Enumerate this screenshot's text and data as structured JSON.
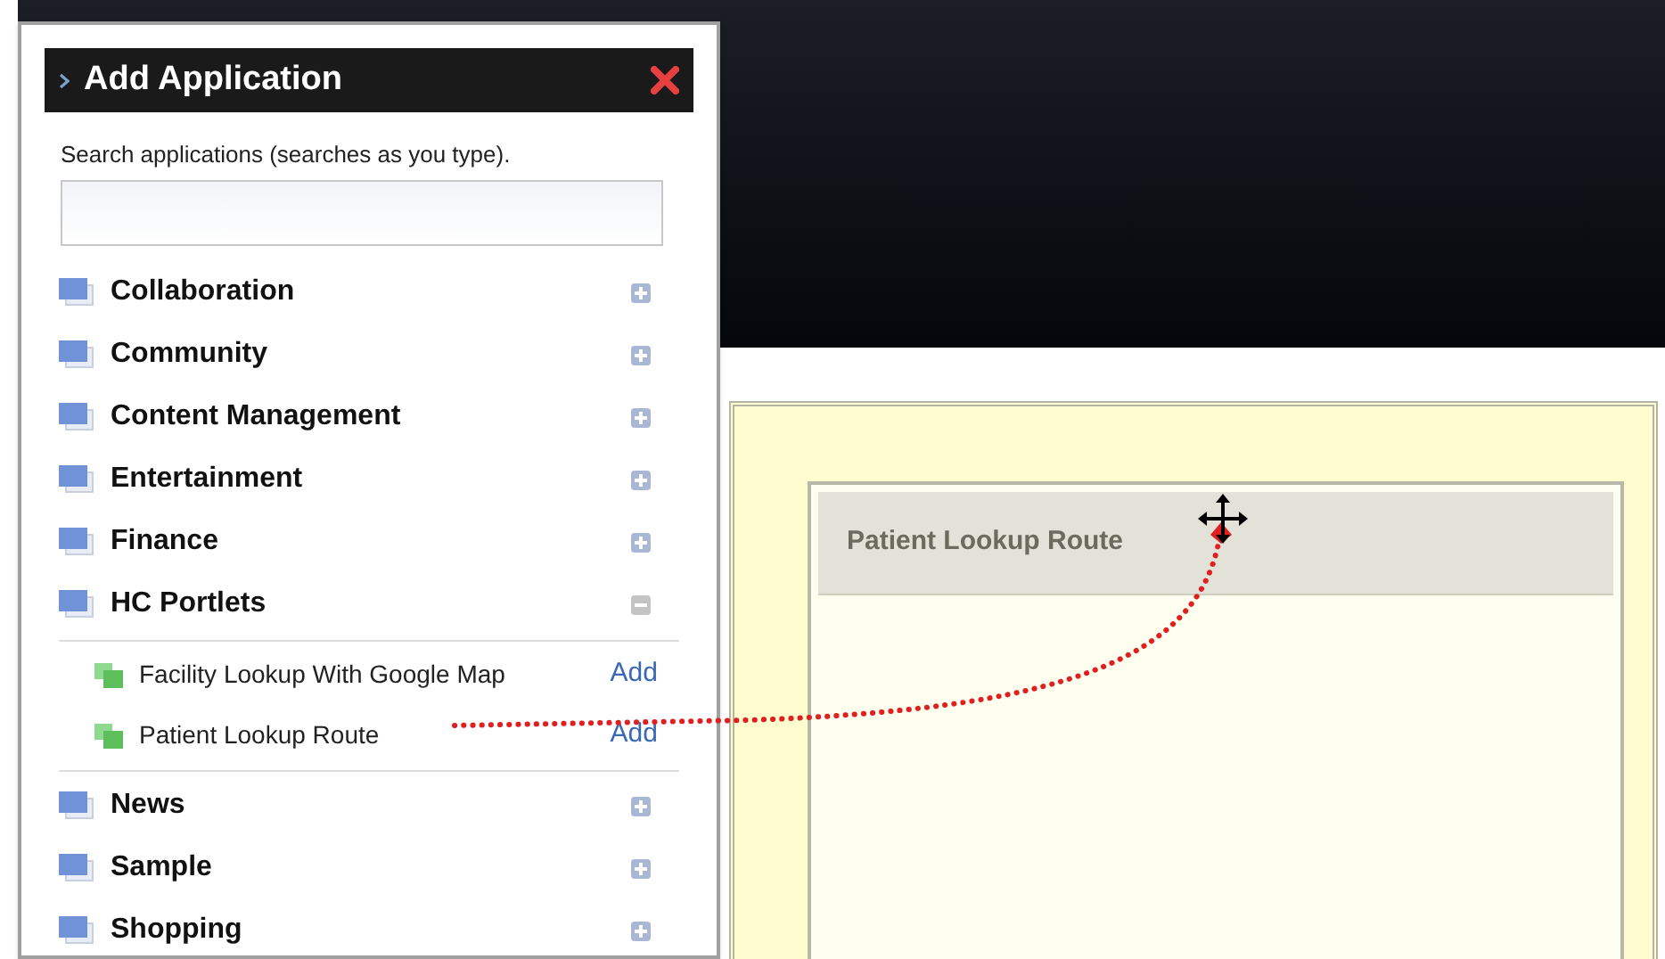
{
  "dialog": {
    "title": "Add Application",
    "search": {
      "label": "Search applications (searches as you type)."
    },
    "categories": [
      {
        "label": "Collaboration",
        "expanded": false
      },
      {
        "label": "Community",
        "expanded": false
      },
      {
        "label": "Content Management",
        "expanded": false
      },
      {
        "label": "Entertainment",
        "expanded": false
      },
      {
        "label": "Finance",
        "expanded": false
      },
      {
        "label": "HC Portlets",
        "expanded": true,
        "children": [
          {
            "label": "Facility Lookup With Google Map",
            "action": "Add"
          },
          {
            "label": "Patient Lookup Route",
            "action": "Add"
          }
        ]
      },
      {
        "label": "News",
        "expanded": false
      },
      {
        "label": "Sample",
        "expanded": false
      },
      {
        "label": "Shopping",
        "expanded": false
      }
    ]
  },
  "page": {
    "portlet": {
      "title": "Patient Lookup Route"
    }
  }
}
